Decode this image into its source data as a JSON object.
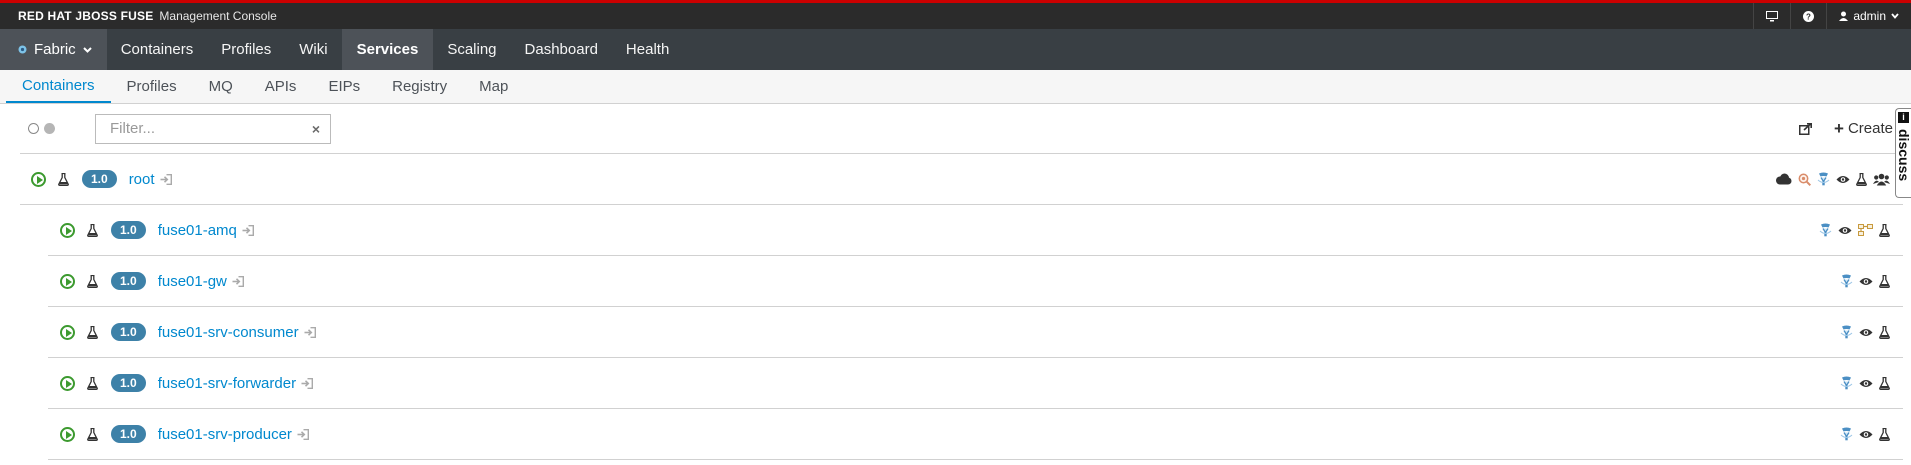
{
  "brand": {
    "name": "RED HAT JBOSS FUSE",
    "subtitle": "Management Console"
  },
  "topbar": {
    "user": "admin",
    "icons": [
      "monitor-icon",
      "help-icon",
      "user-icon"
    ]
  },
  "mainnav": {
    "fabric_label": "Fabric",
    "items": [
      "Containers",
      "Profiles",
      "Wiki",
      "Services",
      "Scaling",
      "Dashboard",
      "Health"
    ],
    "active": "Services"
  },
  "subnav": {
    "items": [
      "Containers",
      "Profiles",
      "MQ",
      "APIs",
      "EIPs",
      "Registry",
      "Map"
    ],
    "active": "Containers"
  },
  "toolbar": {
    "filter_placeholder": "Filter...",
    "filter_value": "",
    "clear_symbol": "×",
    "create_label": "Create"
  },
  "containers": [
    {
      "version": "1.0",
      "name": "root",
      "status": "running",
      "services": [
        "cloud-icon",
        "zoom-icon",
        "blueprint-icon",
        "eye-icon",
        "flask-icon",
        "users-icon"
      ]
    },
    {
      "version": "1.0",
      "name": "fuse01-amq",
      "status": "running",
      "services": [
        "blueprint-icon",
        "eye-icon",
        "broker-icon",
        "flask-icon"
      ]
    },
    {
      "version": "1.0",
      "name": "fuse01-gw",
      "status": "running",
      "services": [
        "blueprint-icon",
        "eye-icon",
        "flask-icon"
      ]
    },
    {
      "version": "1.0",
      "name": "fuse01-srv-consumer",
      "status": "running",
      "services": [
        "blueprint-icon",
        "eye-icon",
        "flask-icon"
      ]
    },
    {
      "version": "1.0",
      "name": "fuse01-srv-forwarder",
      "status": "running",
      "services": [
        "blueprint-icon",
        "eye-icon",
        "flask-icon"
      ]
    },
    {
      "version": "1.0",
      "name": "fuse01-srv-producer",
      "status": "running",
      "services": [
        "blueprint-icon",
        "eye-icon",
        "flask-icon"
      ]
    }
  ],
  "discuss": {
    "label": "discuss",
    "cap": "i"
  },
  "colors": {
    "accent": "#0088ce",
    "header": "#393f44",
    "brandbar": "#2b2b2b",
    "topline": "#cc0000",
    "badge": "#3d81a8",
    "running": "#3c9a2f"
  }
}
